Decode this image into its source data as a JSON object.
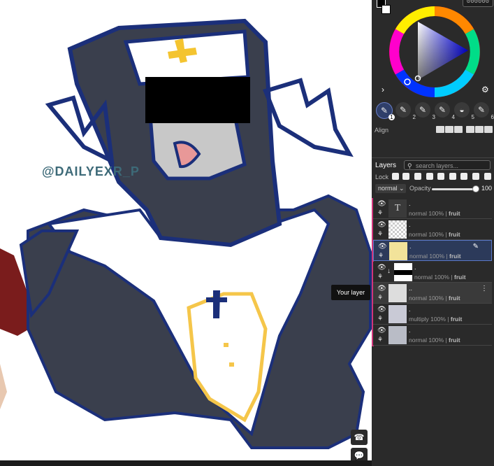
{
  "canvas": {
    "watermark": "@DAILYEXR_P"
  },
  "float_buttons": {
    "phone": "☎",
    "chat": "💬"
  },
  "color_panel": {
    "hex_value": "000000",
    "primary_color": "#000000",
    "secondary_color": "#ffffff",
    "expand_icon": "›",
    "settings_icon": "⚙"
  },
  "brushes": [
    {
      "num": "1",
      "active": true
    },
    {
      "num": "2"
    },
    {
      "num": "3"
    },
    {
      "num": "4"
    },
    {
      "num": "5"
    },
    {
      "num": "6"
    }
  ],
  "align": {
    "label": "Align"
  },
  "layers_panel": {
    "title": "Layers",
    "search_placeholder": "search layers...",
    "lock_label": "Lock",
    "blend_mode": "normal",
    "opacity_label": "Opacity",
    "opacity_value": "100",
    "tooltip": "Your layer",
    "layers": [
      {
        "name": ".",
        "mode": "normal 100%",
        "group": "fruit",
        "type": "text"
      },
      {
        "name": ".",
        "mode": "normal 100%",
        "group": "fruit",
        "type": "empty"
      },
      {
        "name": ".",
        "mode": "normal 100%",
        "group": "fruit",
        "type": "color",
        "selected": true
      },
      {
        "name": ".",
        "mode": "normal 100%",
        "group": "fruit",
        "type": "black",
        "clipped": true
      },
      {
        "name": "..",
        "mode": "normal 100%",
        "group": "fruit",
        "type": "sketch",
        "hover": true
      },
      {
        "name": ".",
        "mode": "multiply 100%",
        "group": "fruit",
        "type": "sketch2"
      },
      {
        "name": ".",
        "mode": "normal 100%",
        "group": "fruit",
        "type": "sketch3"
      }
    ]
  }
}
